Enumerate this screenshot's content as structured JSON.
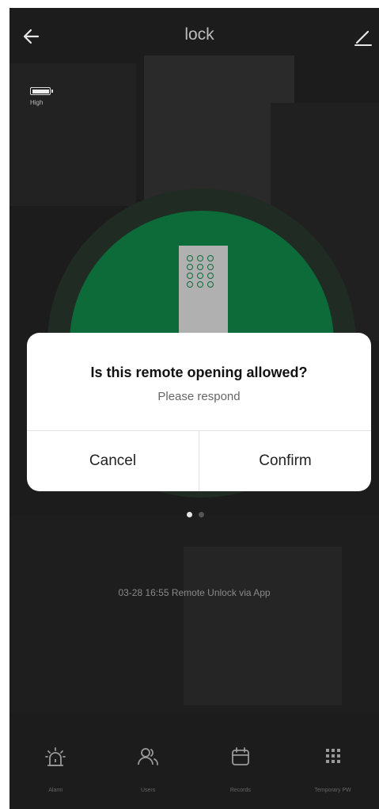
{
  "header": {
    "title": "lock",
    "back_icon": "arrow-left-icon",
    "edit_icon": "pencil-icon"
  },
  "battery": {
    "label": "High",
    "icon": "battery-icon"
  },
  "dialog": {
    "title": "Is this remote opening allowed?",
    "subtitle": "Please respond",
    "cancel_label": "Cancel",
    "confirm_label": "Confirm"
  },
  "pager": {
    "count": 2,
    "active_index": 0
  },
  "event_log": {
    "text": "03-28 16:55 Remote Unlock via App"
  },
  "bottom_nav": {
    "items": [
      {
        "label": "Alarm",
        "icon": "alarm-icon"
      },
      {
        "label": "Users",
        "icon": "users-icon"
      },
      {
        "label": "Records",
        "icon": "calendar-icon"
      },
      {
        "label": "Temporary PW",
        "icon": "keypad-icon"
      }
    ]
  },
  "colors": {
    "accent_green": "#0d6b3a",
    "background": "#1c1c1c",
    "dialog_bg": "#ffffff"
  }
}
